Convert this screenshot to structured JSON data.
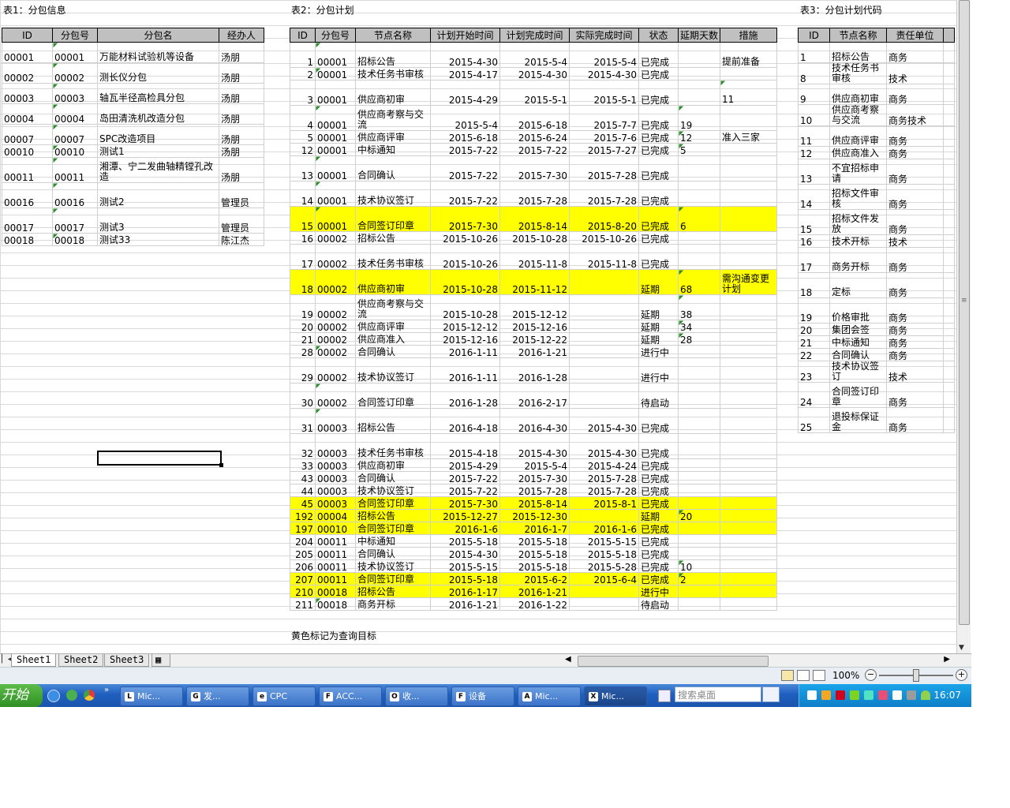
{
  "captions": {
    "t1": "表1：分包信息",
    "t2": "表2：分包计划",
    "t3": "表3：分包计划代码",
    "note": "黄色标记为查询目标"
  },
  "table1": {
    "headers": [
      "ID",
      "分包号",
      "分包名",
      "经办人"
    ],
    "rows": [
      [
        "00001",
        "00001",
        "万能材料试验机等设备",
        "汤朋"
      ],
      [
        "00002",
        "00002",
        "测长仪分包",
        "汤朋"
      ],
      [
        "00003",
        "00003",
        "轴瓦半径高检具分包",
        "汤朋"
      ],
      [
        "00004",
        "00004",
        "岛田清洗机改造分包",
        "汤朋"
      ],
      [
        "00007",
        "00007",
        "SPC改造项目",
        "汤朋"
      ],
      [
        "00010",
        "00010",
        "测试1",
        "汤朋"
      ],
      [
        "00011",
        "00011",
        "湘潭、宁二发曲轴精镗孔改造",
        "汤朋"
      ],
      [
        "00016",
        "00016",
        "测试2",
        "管理员"
      ],
      [
        "00017",
        "00017",
        "测试3",
        "管理员"
      ],
      [
        "00018",
        "00018",
        "测试33",
        "陈江杰"
      ]
    ]
  },
  "table2": {
    "headers": [
      "ID",
      "分包号",
      "节点名称",
      "计划开始时间",
      "计划完成时间",
      "实际完成时间",
      "状态",
      "延期天数",
      "措施"
    ],
    "rows": [
      [
        "1",
        "00001",
        "招标公告",
        "2015-4-30",
        "2015-5-4",
        "2015-5-4",
        "已完成",
        "",
        "提前准备"
      ],
      [
        "2",
        "00001",
        "技术任务书审核",
        "2015-4-17",
        "2015-4-30",
        "2015-4-30",
        "已完成",
        "",
        ""
      ],
      [
        "3",
        "00001",
        "供应商初审",
        "2015-4-29",
        "2015-5-1",
        "2015-5-1",
        "已完成",
        "",
        "11"
      ],
      [
        "4",
        "00001",
        "供应商考察与交流",
        "2015-5-4",
        "2015-6-18",
        "2015-7-7",
        "已完成",
        "19",
        ""
      ],
      [
        "5",
        "00001",
        "供应商评审",
        "2015-6-18",
        "2015-6-24",
        "2015-7-6",
        "已完成",
        "12",
        "准入三家"
      ],
      [
        "12",
        "00001",
        "中标通知",
        "2015-7-22",
        "2015-7-22",
        "2015-7-27",
        "已完成",
        "5",
        ""
      ],
      [
        "13",
        "00001",
        "合同确认",
        "2015-7-22",
        "2015-7-30",
        "2015-7-28",
        "已完成",
        "",
        ""
      ],
      [
        "14",
        "00001",
        "技术协议签订",
        "2015-7-22",
        "2015-7-28",
        "2015-7-28",
        "已完成",
        "",
        ""
      ],
      [
        "15",
        "00001",
        "合同签订印章",
        "2015-7-30",
        "2015-8-14",
        "2015-8-20",
        "已完成",
        "6",
        ""
      ],
      [
        "16",
        "00002",
        "招标公告",
        "2015-10-26",
        "2015-10-28",
        "2015-10-26",
        "已完成",
        "",
        ""
      ],
      [
        "17",
        "00002",
        "技术任务书审核",
        "2015-10-26",
        "2015-11-8",
        "2015-11-8",
        "已完成",
        "",
        ""
      ],
      [
        "18",
        "00002",
        "供应商初审",
        "2015-10-28",
        "2015-11-12",
        "",
        "延期",
        "68",
        "需沟通变更计划"
      ],
      [
        "19",
        "00002",
        "供应商考察与交流",
        "2015-10-28",
        "2015-12-12",
        "",
        "延期",
        "38",
        ""
      ],
      [
        "20",
        "00002",
        "供应商评审",
        "2015-12-12",
        "2015-12-16",
        "",
        "延期",
        "34",
        ""
      ],
      [
        "21",
        "00002",
        "供应商准入",
        "2015-12-16",
        "2015-12-22",
        "",
        "延期",
        "28",
        ""
      ],
      [
        "28",
        "00002",
        "合同确认",
        "2016-1-11",
        "2016-1-21",
        "",
        "进行中",
        "",
        ""
      ],
      [
        "29",
        "00002",
        "技术协议签订",
        "2016-1-11",
        "2016-1-28",
        "",
        "进行中",
        "",
        ""
      ],
      [
        "30",
        "00002",
        "合同签订印章",
        "2016-1-28",
        "2016-2-17",
        "",
        "待启动",
        "",
        ""
      ],
      [
        "31",
        "00003",
        "招标公告",
        "2016-4-18",
        "2016-4-30",
        "2015-4-30",
        "已完成",
        "",
        ""
      ],
      [
        "32",
        "00003",
        "技术任务书审核",
        "2015-4-18",
        "2015-4-30",
        "2015-4-30",
        "已完成",
        "",
        ""
      ],
      [
        "33",
        "00003",
        "供应商初审",
        "2015-4-29",
        "2015-5-4",
        "2015-4-24",
        "已完成",
        "",
        ""
      ],
      [
        "43",
        "00003",
        "合同确认",
        "2015-7-22",
        "2015-7-30",
        "2015-7-28",
        "已完成",
        "",
        ""
      ],
      [
        "44",
        "00003",
        "技术协议签订",
        "2015-7-22",
        "2015-7-28",
        "2015-7-28",
        "已完成",
        "",
        ""
      ],
      [
        "45",
        "00003",
        "合同签订印章",
        "2015-7-30",
        "2015-8-14",
        "2015-8-1",
        "已完成",
        "",
        ""
      ],
      [
        "192",
        "00004",
        "招标公告",
        "2015-12-27",
        "2015-12-30",
        "",
        "延期",
        "20",
        ""
      ],
      [
        "197",
        "00010",
        "合同签订印章",
        "2016-1-6",
        "2016-1-7",
        "2016-1-6",
        "已完成",
        "",
        ""
      ],
      [
        "204",
        "00011",
        "中标通知",
        "2015-5-18",
        "2015-5-18",
        "2015-5-15",
        "已完成",
        "",
        ""
      ],
      [
        "205",
        "00011",
        "合同确认",
        "2015-4-30",
        "2015-5-18",
        "2015-5-18",
        "已完成",
        "",
        ""
      ],
      [
        "206",
        "00011",
        "技术协议签订",
        "2015-5-15",
        "2015-5-18",
        "2015-5-28",
        "已完成",
        "10",
        ""
      ],
      [
        "207",
        "00011",
        "合同签订印章",
        "2015-5-18",
        "2015-6-2",
        "2015-6-4",
        "已完成",
        "2",
        ""
      ],
      [
        "210",
        "00018",
        "招标公告",
        "2016-1-17",
        "2016-1-21",
        "",
        "进行中",
        "",
        ""
      ],
      [
        "211",
        "00018",
        "商务开标",
        "2016-1-21",
        "2016-1-22",
        "",
        "待启动",
        "",
        ""
      ]
    ]
  },
  "table3": {
    "headers": [
      "ID",
      "节点名称",
      "责任单位"
    ],
    "rows": [
      [
        "1",
        "招标公告",
        "商务"
      ],
      [
        "8",
        "技术任务书审核",
        "技术"
      ],
      [
        "9",
        "供应商初审",
        "商务"
      ],
      [
        "10",
        "供应商考察与交流",
        "商务技术"
      ],
      [
        "11",
        "供应商评审",
        "商务"
      ],
      [
        "12",
        "供应商准入",
        "商务"
      ],
      [
        "13",
        "不宜招标申请",
        "商务"
      ],
      [
        "14",
        "招标文件审核",
        "商务"
      ],
      [
        "15",
        "招标文件发放",
        "商务"
      ],
      [
        "16",
        "技术开标",
        "技术"
      ],
      [
        "17",
        "商务开标",
        "商务"
      ],
      [
        "18",
        "定标",
        "商务"
      ],
      [
        "19",
        "价格审批",
        "商务"
      ],
      [
        "20",
        "集团会签",
        "商务"
      ],
      [
        "21",
        "中标通知",
        "商务"
      ],
      [
        "22",
        "合同确认",
        "商务"
      ],
      [
        "23",
        "技术协议签订",
        "技术"
      ],
      [
        "24",
        "合同签订印章",
        "商务"
      ],
      [
        "25",
        "退投标保证金",
        "商务"
      ]
    ]
  },
  "sheets": [
    "Sheet1",
    "Sheet2",
    "Sheet3"
  ],
  "status": {
    "zoom": "100%"
  },
  "taskbar": {
    "start": "开始",
    "tasks": [
      {
        "icon": "L",
        "label": "Mic..."
      },
      {
        "icon": "G",
        "label": "发..."
      },
      {
        "icon": "e",
        "label": "CPC"
      },
      {
        "icon": "F",
        "label": "ACC..."
      },
      {
        "icon": "O",
        "label": "收..."
      },
      {
        "icon": "F",
        "label": "设备"
      },
      {
        "icon": "A",
        "label": "Mic..."
      },
      {
        "icon": "X",
        "label": "Mic..."
      }
    ],
    "search_placeholder": "搜索桌面",
    "clock": "16:07"
  },
  "colors": {
    "highlight": "#ffff00",
    "header": "#c0c0c0",
    "taskbar": "#1f5fbf",
    "start": "#2f8f23"
  }
}
